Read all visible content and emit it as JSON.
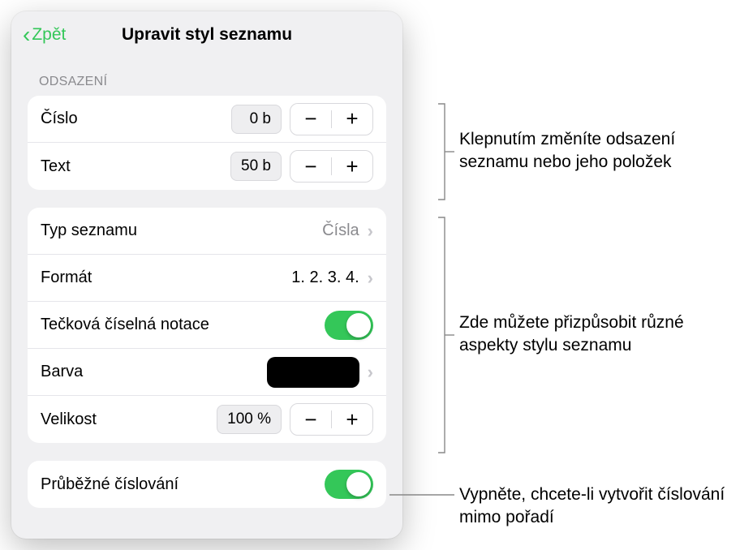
{
  "header": {
    "back": "Zpět",
    "title": "Upravit styl seznamu"
  },
  "section_indent": {
    "heading": "ODSAZENÍ",
    "number_label": "Číslo",
    "number_value": "0 b",
    "text_label": "Text",
    "text_value": "50 b"
  },
  "section_style": {
    "list_type_label": "Typ seznamu",
    "list_type_value": "Čísla",
    "format_label": "Formát",
    "format_value": "1. 2. 3. 4.",
    "dotted_label": "Tečková číselná notace",
    "color_label": "Barva",
    "size_label": "Velikost",
    "size_value": "100 %"
  },
  "continuous": {
    "label": "Průběžné číslování"
  },
  "callouts": {
    "indent": "Klepnutím změníte odsazení seznamu nebo jeho položek",
    "style": "Zde můžete přizpůsobit různé aspekty stylu seznamu",
    "continuous": "Vypněte, chcete-li vytvořit číslování mimo pořadí"
  },
  "glyphs": {
    "minus": "−",
    "plus": "+"
  }
}
